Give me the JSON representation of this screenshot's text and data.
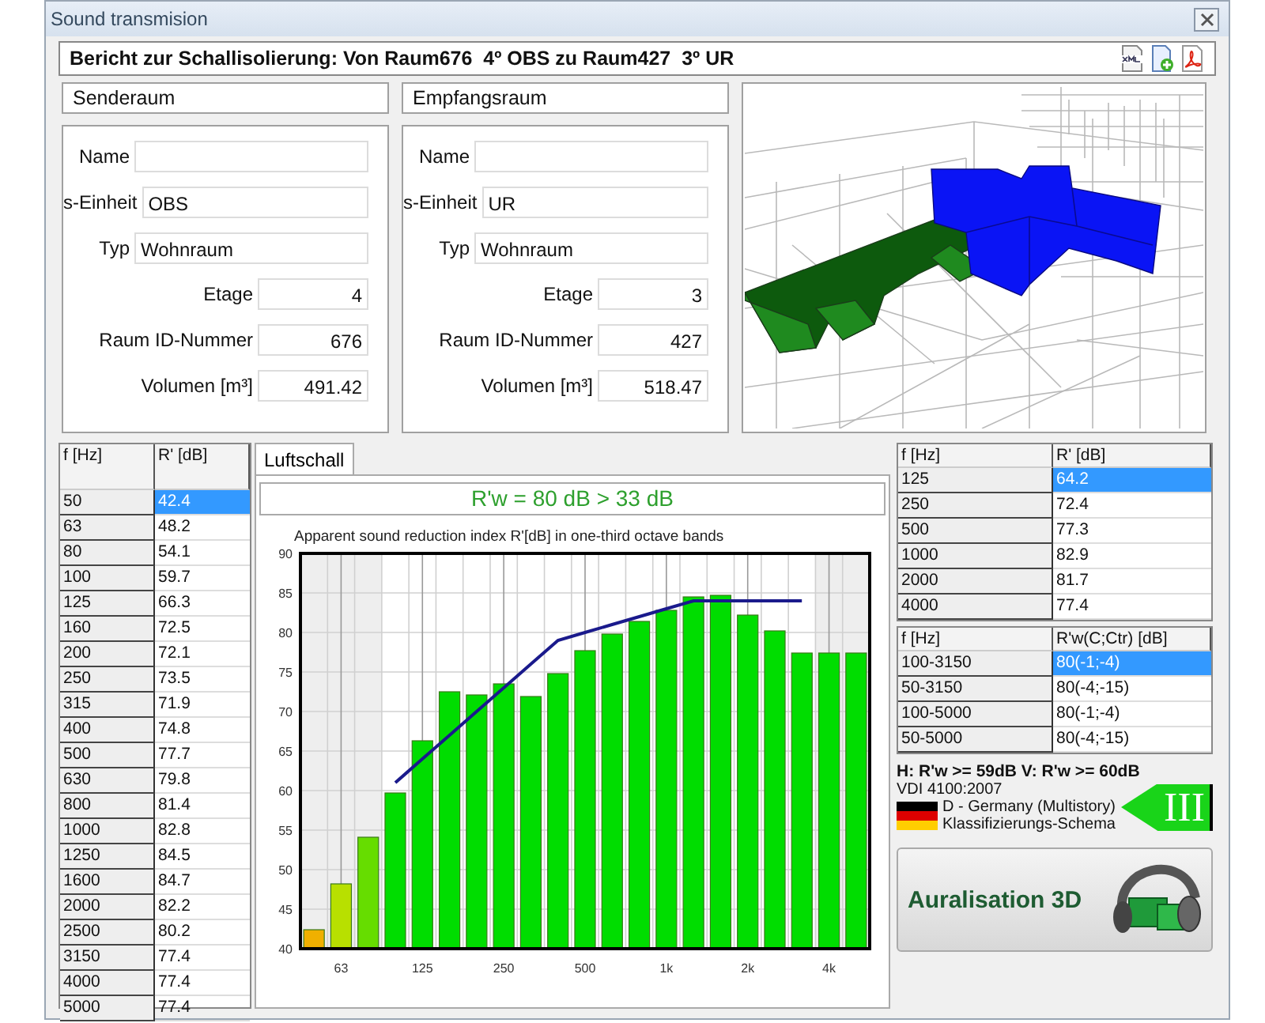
{
  "window": {
    "title": "Sound transmision"
  },
  "header": {
    "title": "Bericht zur Schallisolierung: Von Raum676  4º OBS zu Raum427  3º UR"
  },
  "rooms": [
    {
      "heading": "Senderaum",
      "fields": [
        {
          "label": "Name",
          "kind": "text"
        },
        {
          "label": "s-Einheit",
          "value": "OBS",
          "kind": "text"
        },
        {
          "label": "Typ",
          "value": "Wohnraum",
          "kind": "text"
        },
        {
          "label": "Etage",
          "value": "4",
          "kind": "number"
        },
        {
          "label": "Raum ID-Nummer",
          "value": "676",
          "kind": "number"
        },
        {
          "label": "Volumen [m³]",
          "value": "491.42",
          "kind": "number"
        }
      ]
    },
    {
      "heading": "Empfangsraum",
      "fields": [
        {
          "label": "Name",
          "kind": "text"
        },
        {
          "label": "s-Einheit",
          "value": "UR",
          "kind": "text"
        },
        {
          "label": "Typ",
          "value": "Wohnraum",
          "kind": "text"
        },
        {
          "label": "Etage",
          "value": "3",
          "kind": "number"
        },
        {
          "label": "Raum ID-Nummer",
          "value": "427",
          "kind": "number"
        },
        {
          "label": "Volumen [m³]",
          "value": "518.47",
          "kind": "number"
        }
      ]
    }
  ],
  "spectrum_table": {
    "columns": [
      "f [Hz]",
      "R' [dB]"
    ],
    "rows": [
      {
        "cells": [
          "50",
          "42.4"
        ],
        "selected": true
      },
      {
        "cells": [
          "63",
          "48.2"
        ],
        "selected": false
      },
      {
        "cells": [
          "80",
          "54.1"
        ],
        "selected": false
      },
      {
        "cells": [
          "100",
          "59.7"
        ],
        "selected": false
      },
      {
        "cells": [
          "125",
          "66.3"
        ],
        "selected": false
      },
      {
        "cells": [
          "160",
          "72.5"
        ],
        "selected": false
      },
      {
        "cells": [
          "200",
          "72.1"
        ],
        "selected": false
      },
      {
        "cells": [
          "250",
          "73.5"
        ],
        "selected": false
      },
      {
        "cells": [
          "315",
          "71.9"
        ],
        "selected": false
      },
      {
        "cells": [
          "400",
          "74.8"
        ],
        "selected": false
      },
      {
        "cells": [
          "500",
          "77.7"
        ],
        "selected": false
      },
      {
        "cells": [
          "630",
          "79.8"
        ],
        "selected": false
      },
      {
        "cells": [
          "800",
          "81.4"
        ],
        "selected": false
      },
      {
        "cells": [
          "1000",
          "82.8"
        ],
        "selected": false
      },
      {
        "cells": [
          "1250",
          "84.5"
        ],
        "selected": false
      },
      {
        "cells": [
          "1600",
          "84.7"
        ],
        "selected": false
      },
      {
        "cells": [
          "2000",
          "82.2"
        ],
        "selected": false
      },
      {
        "cells": [
          "2500",
          "80.2"
        ],
        "selected": false
      },
      {
        "cells": [
          "3150",
          "77.4"
        ],
        "selected": false
      },
      {
        "cells": [
          "4000",
          "77.4"
        ],
        "selected": false
      },
      {
        "cells": [
          "5000",
          "77.4"
        ],
        "selected": false
      }
    ]
  },
  "tabs": [
    {
      "label": "Luftschall",
      "selected": true
    }
  ],
  "result": "R'w = 80 dB > 33 dB",
  "chart_data": {
    "type": "bar",
    "title": "Apparent sound reduction index R'[dB] in one-third octave bands",
    "categories": [
      null,
      "63",
      null,
      null,
      "125",
      null,
      null,
      "250",
      null,
      null,
      "500",
      null,
      null,
      "1k",
      null,
      null,
      "2k",
      null,
      null,
      "4k",
      null
    ],
    "series": [
      {
        "color": "#f0b000",
        "values": [
          42.4,
          null,
          null,
          null,
          null,
          null,
          null,
          null,
          null,
          null,
          null,
          null,
          null,
          null,
          null,
          null,
          null,
          null,
          null,
          null,
          null
        ]
      },
      {
        "color": "#b8e000",
        "values": [
          null,
          48.2,
          null,
          null,
          null,
          null,
          null,
          null,
          null,
          null,
          null,
          null,
          null,
          null,
          null,
          null,
          null,
          null,
          null,
          null,
          null
        ]
      },
      {
        "color": "#66dd00",
        "values": [
          null,
          null,
          54.1,
          null,
          null,
          null,
          null,
          null,
          null,
          null,
          null,
          null,
          null,
          null,
          null,
          null,
          null,
          null,
          null,
          null,
          null
        ]
      },
      {
        "color": "#00dd00",
        "values": [
          null,
          null,
          null,
          59.7,
          66.3,
          72.5,
          72.1,
          73.5,
          71.9,
          74.8,
          77.7,
          79.8,
          81.4,
          82.8,
          84.5,
          84.7,
          82.2,
          80.2,
          77.4,
          77.4,
          77.4
        ]
      },
      {
        "type": "line",
        "color": "#1a1a8c",
        "values": [
          null,
          null,
          null,
          61,
          64,
          67,
          70,
          73,
          76,
          79,
          80,
          81,
          82,
          83,
          84,
          84,
          84,
          84,
          84,
          null,
          null
        ]
      }
    ],
    "grid": true,
    "ylim": [
      40,
      90
    ],
    "yticks": [
      40,
      45,
      50,
      55,
      60,
      65,
      70,
      75,
      80,
      85,
      90
    ]
  },
  "octave_table": {
    "columns": [
      "f [Hz]",
      "R' [dB]"
    ],
    "rows": [
      {
        "cells": [
          "125",
          "64.2"
        ],
        "selected": true
      },
      {
        "cells": [
          "250",
          "72.4"
        ],
        "selected": false
      },
      {
        "cells": [
          "500",
          "77.3"
        ],
        "selected": false
      },
      {
        "cells": [
          "1000",
          "82.9"
        ],
        "selected": false
      },
      {
        "cells": [
          "2000",
          "81.7"
        ],
        "selected": false
      },
      {
        "cells": [
          "4000",
          "77.4"
        ],
        "selected": false
      }
    ]
  },
  "rating_table": {
    "columns": [
      "f [Hz]",
      "R'w(C;Ctr) [dB]"
    ],
    "rows": [
      {
        "cells": [
          "100-3150",
          "80(-1;-4)"
        ],
        "selected": true
      },
      {
        "cells": [
          "50-3150",
          "80(-4;-15)"
        ],
        "selected": false
      },
      {
        "cells": [
          "100-5000",
          "80(-1;-4)"
        ],
        "selected": false
      },
      {
        "cells": [
          "50-5000",
          "80(-4;-15)"
        ],
        "selected": false
      }
    ]
  },
  "classification": {
    "requirement": "H: R'w >= 59dB V: R'w >= 60dB",
    "standard": "VDI 4100:2007",
    "country": "D - Germany (Multistory)",
    "scheme": "Klassifizierungs-Schema",
    "class": "III"
  },
  "auralisation_button": {
    "label": "Auralisation 3D"
  }
}
